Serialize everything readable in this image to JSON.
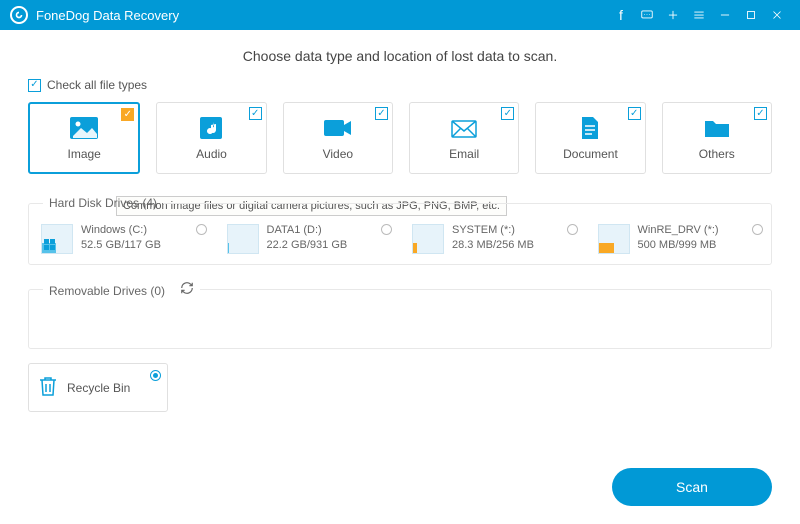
{
  "app": {
    "title": "FoneDog Data Recovery"
  },
  "headline": "Choose data type and location of lost data to scan.",
  "check_all_label": "Check all file types",
  "types": {
    "image": "Image",
    "audio": "Audio",
    "video": "Video",
    "email": "Email",
    "document": "Document",
    "others": "Others"
  },
  "tooltip": "Common image files or digital camera pictures, such as JPG, PNG, BMP, etc.",
  "hdd_legend": "Hard Disk Drives (4)",
  "drives": [
    {
      "name": "Windows (C:)",
      "size": "52.5 GB/117 GB",
      "fill": 45,
      "color": "#56c2ea"
    },
    {
      "name": "DATA1 (D:)",
      "size": "22.2 GB/931 GB",
      "fill": 4,
      "color": "#56c2ea"
    },
    {
      "name": "SYSTEM (*:)",
      "size": "28.3 MB/256 MB",
      "fill": 12,
      "color": "#f9a825"
    },
    {
      "name": "WinRE_DRV (*:)",
      "size": "500 MB/999 MB",
      "fill": 50,
      "color": "#f9a825"
    }
  ],
  "removable_legend": "Removable Drives (0)",
  "recycle_label": "Recycle Bin",
  "scan_label": "Scan"
}
